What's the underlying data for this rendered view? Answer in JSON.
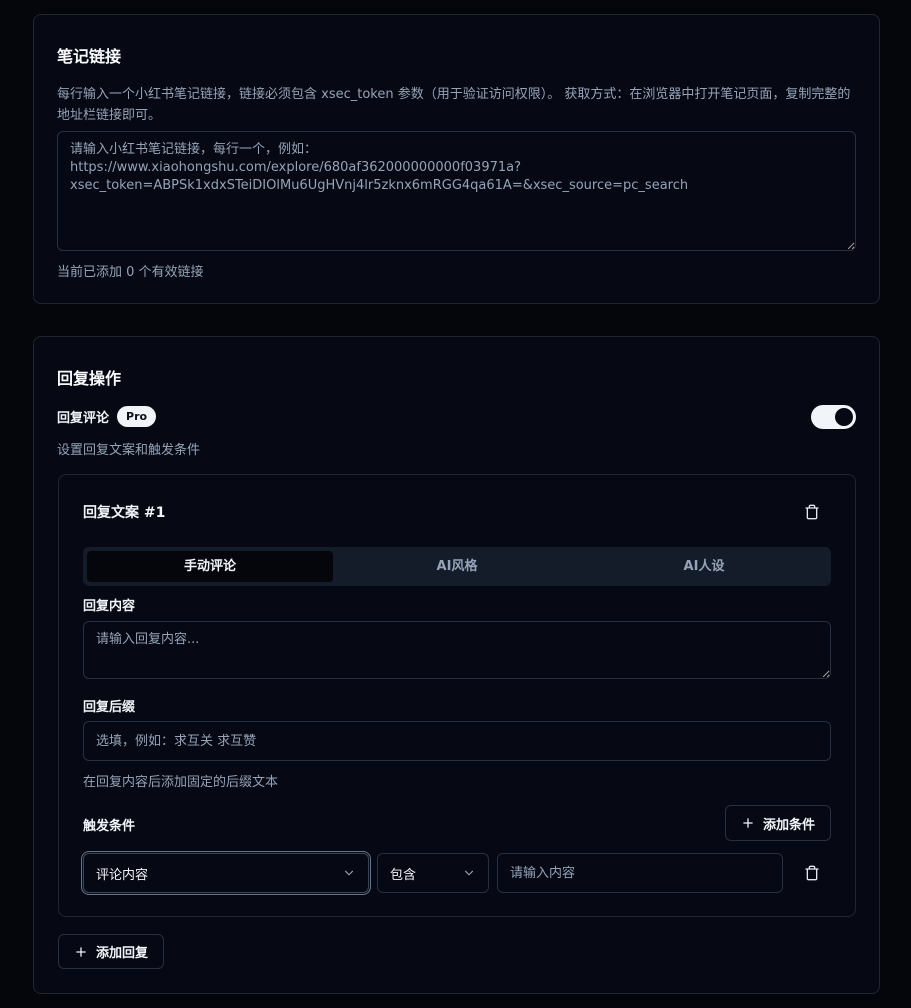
{
  "links_card": {
    "title": "笔记链接",
    "description": "每行输入一个小红书笔记链接，链接必须包含 xsec_token 参数（用于验证访问权限）。 获取方式：在浏览器中打开笔记页面，复制完整的地址栏链接即可。",
    "textarea_placeholder": "请输入小红书笔记链接，每行一个，例如：\nhttps://www.xiaohongshu.com/explore/680af362000000000f03971a?xsec_token=ABPSk1xdxSTeiDIOlMu6UgHVnj4lr5zknx6mRGG4qa61A=&xsec_source=pc_search",
    "status": "当前已添加 0 个有效链接"
  },
  "reply_card": {
    "title": "回复操作",
    "reply_comment_label": "回复评论",
    "pro_badge": "Pro",
    "toggle_on": true,
    "subtitle": "设置回复文案和触发条件",
    "reply_item": {
      "title": "回复文案 #1",
      "tabs": [
        {
          "label": "手动评论",
          "active": true
        },
        {
          "label": "AI风格",
          "active": false
        },
        {
          "label": "AI人设",
          "active": false
        }
      ],
      "content_label": "回复内容",
      "content_placeholder": "请输入回复内容...",
      "suffix_label": "回复后缀",
      "suffix_placeholder": "选填，例如：求互关 求互赞",
      "suffix_hint": "在回复内容后添加固定的后缀文本",
      "conditions_label": "触发条件",
      "add_condition_label": "添加条件",
      "condition": {
        "field": "评论内容",
        "operator": "包含",
        "value_placeholder": "请输入内容"
      }
    },
    "add_reply_label": "添加回复"
  },
  "colors": {
    "background": "#04060c",
    "card": "#060913",
    "border": "#1f2532",
    "muted_text": "#94a3b8",
    "tab_track": "#151c29"
  }
}
